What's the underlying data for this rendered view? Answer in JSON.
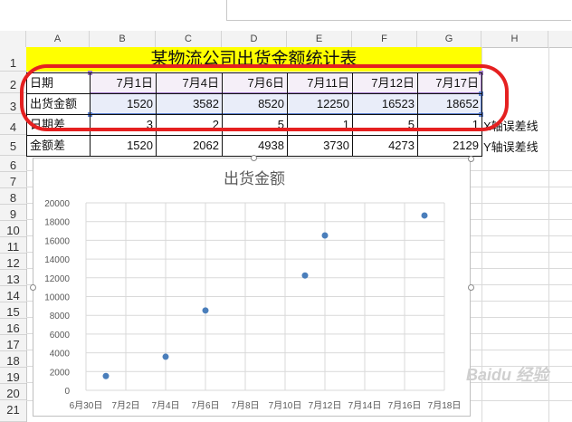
{
  "columns": [
    "A",
    "B",
    "C",
    "D",
    "E",
    "F",
    "G",
    "H"
  ],
  "rows": [
    "1",
    "2",
    "3",
    "4",
    "5",
    "6",
    "7",
    "8",
    "9",
    "10",
    "11",
    "12",
    "13",
    "14",
    "15",
    "16",
    "17",
    "18",
    "19",
    "20",
    "21"
  ],
  "sheet": {
    "title": "某物流公司出货金额统计表",
    "r2": {
      "label": "日期",
      "values": [
        "7月1日",
        "7月4日",
        "7月6日",
        "7月11日",
        "7月12日",
        "7月17日"
      ]
    },
    "r3": {
      "label": "出货金额",
      "values": [
        "1520",
        "3582",
        "8520",
        "12250",
        "16523",
        "18652"
      ]
    },
    "r4": {
      "label": "日期差",
      "values": [
        "3",
        "2",
        "5",
        "1",
        "5",
        "1"
      ],
      "note": "X轴误差线"
    },
    "r5": {
      "label": "金额差",
      "values": [
        "1520",
        "2062",
        "4938",
        "3730",
        "4273",
        "2129"
      ],
      "note": "Y轴误差线"
    }
  },
  "chart_data": {
    "type": "scatter",
    "title": "出货金额",
    "series": [
      {
        "x": [
          "7月1日",
          "7月4日",
          "7月6日",
          "7月11日",
          "7月12日",
          "7月17日"
        ],
        "values": [
          1520,
          3582,
          8520,
          12250,
          16523,
          18652
        ]
      }
    ],
    "x_day_values": [
      1,
      4,
      6,
      11,
      12,
      17
    ],
    "x_ticks": [
      "6月30日",
      "7月2日",
      "7月4日",
      "7月6日",
      "7月8日",
      "7月10日",
      "7月12日",
      "7月14日",
      "7月16日",
      "7月18日"
    ],
    "y_ticks": [
      "0",
      "2000",
      "4000",
      "6000",
      "8000",
      "10000",
      "12000",
      "14000",
      "16000",
      "18000",
      "20000"
    ],
    "ylim": [
      0,
      20000
    ],
    "xlim_days": [
      0,
      18
    ],
    "grid": true,
    "marker_color": "#4a7ebb"
  },
  "watermark": "Baidu 经验"
}
